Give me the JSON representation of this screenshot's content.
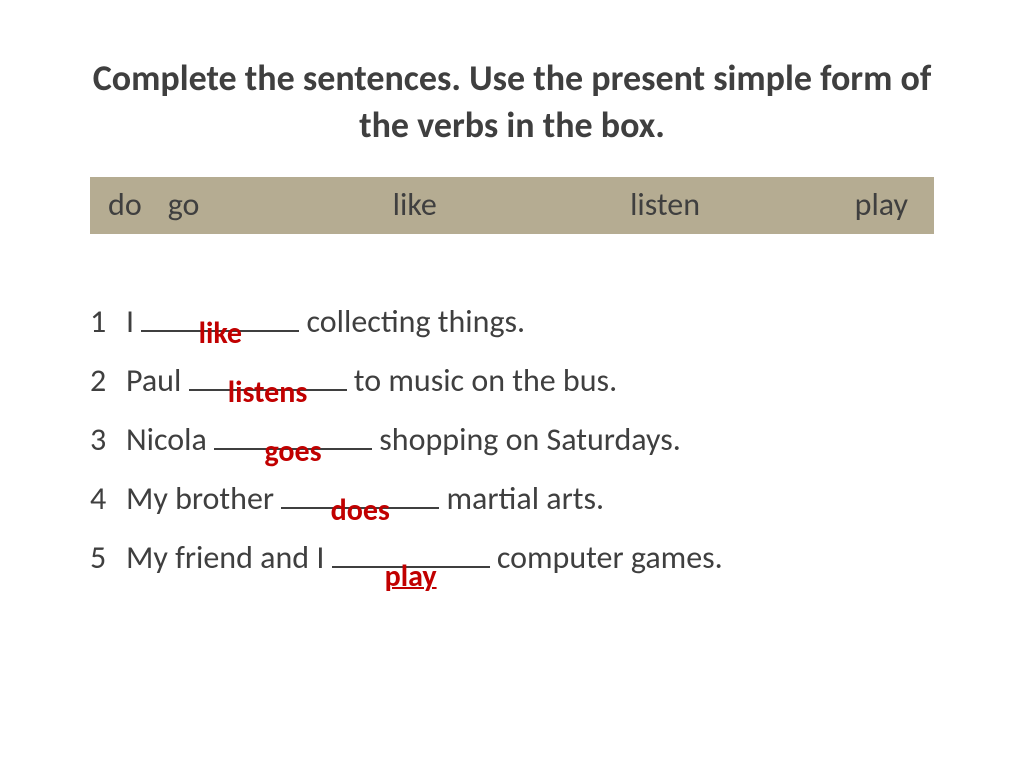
{
  "title": "Complete the sentences. Use the present simple form of  the verbs in the box.",
  "verbs": {
    "v1": "do",
    "v2": "go",
    "v3": "like",
    "v4": "listen",
    "v5": "play"
  },
  "sentences": {
    "s1": {
      "num": "1",
      "before": "I ",
      "answer": "like",
      "after": " collecting things."
    },
    "s2": {
      "num": "2",
      "before": "Paul ",
      "answer": "listens",
      "after": " to music on the bus."
    },
    "s3": {
      "num": "3",
      "before": "Nicola ",
      "answer": "goes",
      "after": " shopping on Saturdays."
    },
    "s4": {
      "num": "4",
      "before": "My brother ",
      "answer": "does",
      "after": " martial arts."
    },
    "s5": {
      "num": "5",
      "before": "My friend and I ",
      "answer": "play",
      "after": " computer games."
    }
  }
}
